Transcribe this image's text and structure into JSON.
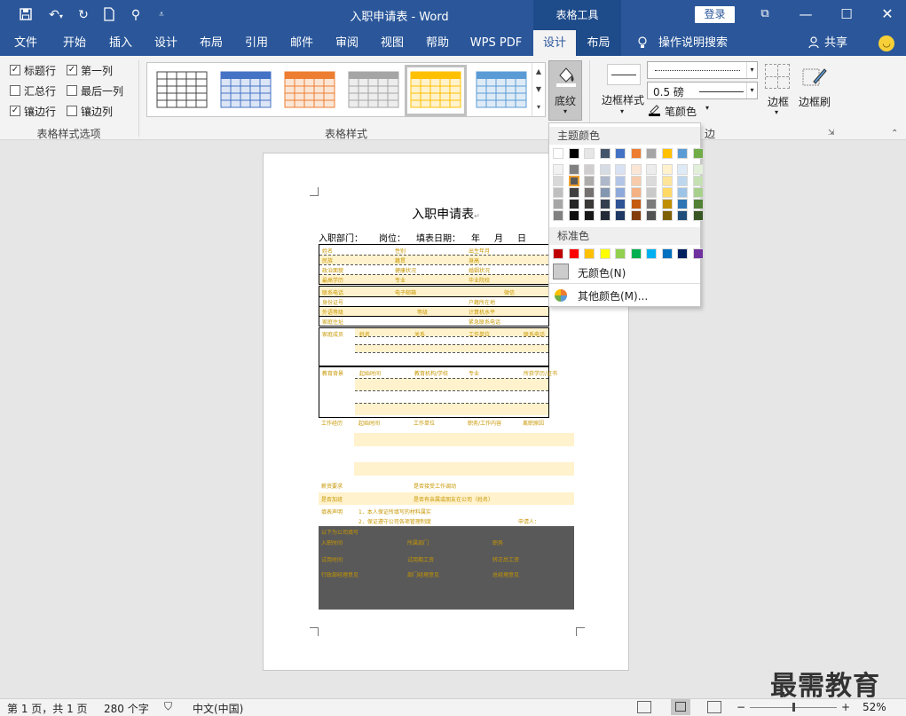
{
  "window": {
    "title": "入职申请表 - Word",
    "context_tab_title": "表格工具",
    "login": "登录"
  },
  "tabs": [
    "文件",
    "开始",
    "插入",
    "设计",
    "布局",
    "引用",
    "邮件",
    "审阅",
    "视图",
    "帮助",
    "WPS PDF",
    "设计",
    "布局"
  ],
  "tell_me": "操作说明搜索",
  "share": "共享",
  "options": {
    "items": [
      {
        "label": "标题行",
        "checked": true
      },
      {
        "label": "第一列",
        "checked": true
      },
      {
        "label": "汇总行",
        "checked": false
      },
      {
        "label": "最后一列",
        "checked": false
      },
      {
        "label": "镶边行",
        "checked": true
      },
      {
        "label": "镶边列",
        "checked": false
      }
    ],
    "group_label": "表格样式选项"
  },
  "styles": {
    "group_label": "表格样式"
  },
  "shading": {
    "label": "底纹"
  },
  "border": {
    "styles_label": "边框样式",
    "width": "0.5 磅",
    "pen_color": "笔颜色",
    "borders": "边框",
    "painter": "边框刷",
    "group_label": "边框"
  },
  "dropdown": {
    "theme_label": "主题颜色",
    "standard_label": "标准色",
    "no_color": "无颜色(N)",
    "more_colors": "其他颜色(M)...",
    "theme_top": [
      "#ffffff",
      "#000000",
      "#e7e6e6",
      "#44546a",
      "#4472c4",
      "#ed7d31",
      "#a5a5a5",
      "#ffc000",
      "#5b9bd5",
      "#70ad47"
    ],
    "theme_shades": [
      [
        "#f2f2f2",
        "#d9d9d9",
        "#bfbfbf",
        "#a6a6a6",
        "#808080"
      ],
      [
        "#808080",
        "#595959",
        "#404040",
        "#262626",
        "#0d0d0d"
      ],
      [
        "#d0cece",
        "#afabab",
        "#767171",
        "#3b3838",
        "#181717"
      ],
      [
        "#d6dce4",
        "#adb9ca",
        "#8497b0",
        "#333f4f",
        "#222a35"
      ],
      [
        "#d9e2f3",
        "#b4c6e7",
        "#8eaadb",
        "#2f5496",
        "#1f3864"
      ],
      [
        "#fbe5d5",
        "#f7cbac",
        "#f4b183",
        "#c55a11",
        "#833c0b"
      ],
      [
        "#ededed",
        "#dbdbdb",
        "#c9c9c9",
        "#7b7b7b",
        "#525252"
      ],
      [
        "#fff2cc",
        "#fee599",
        "#ffd965",
        "#bf8f00",
        "#7f6000"
      ],
      [
        "#deebf6",
        "#bdd7ee",
        "#9dc3e6",
        "#2e75b5",
        "#1e4e79"
      ],
      [
        "#e2efd9",
        "#c5e0b3",
        "#a8d08d",
        "#538135",
        "#375623"
      ]
    ],
    "standard": [
      "#c00000",
      "#ff0000",
      "#ffc000",
      "#ffff00",
      "#92d050",
      "#00b050",
      "#00b0f0",
      "#0070c0",
      "#002060",
      "#7030a0"
    ]
  },
  "document": {
    "title": "入职申请表",
    "header": [
      "入职部门：",
      "岗位：",
      "填表日期：",
      "年",
      "月",
      "日"
    ],
    "rows1": [
      [
        "姓名",
        "性别",
        "出生年月"
      ],
      [
        "民族",
        "籍贯",
        "身高"
      ],
      [
        "政治面貌",
        "健康状况",
        "婚姻状况"
      ],
      [
        "最高学历",
        "专业",
        "毕业院校"
      ]
    ],
    "rows2": [
      [
        "联系电话",
        "电子邮箱",
        "微信"
      ],
      [
        "身份证号",
        "户籍所在地"
      ],
      [
        "外语等级",
        "等级",
        "计算机水平"
      ],
      [
        "家庭住址",
        "紧急联系电话"
      ]
    ],
    "family": [
      "家庭成员",
      "姓名",
      "关系",
      "工作单位",
      "联系电话"
    ],
    "edu": [
      "教育背景",
      "起始时间",
      "教育机构/学校",
      "专业",
      "所获学历/证书"
    ],
    "work": [
      "工作经历",
      "起始时间",
      "工作单位",
      "职务/工作内容",
      "离职原因"
    ],
    "salary": [
      "薪资要求",
      "是否接受工作调动"
    ],
    "relatives": [
      "是否加班",
      "是否有亲属或朋友在公司（姓名）"
    ],
    "statement": [
      "填表声明",
      "1．本人保证所填写的材料属实",
      "2．保证遵守公司各项管理制度",
      "申请人："
    ],
    "office": [
      "以下为公司填写",
      "入职时间",
      "所属部门",
      "职务",
      "试用时间",
      "试用期工资",
      "转正后工资",
      "行政部经理意见",
      "部门经理意见",
      "总经理意见"
    ]
  },
  "status": {
    "page": "第 1 页，共 1 页",
    "words": "280 个字",
    "lang": "中文(中国)",
    "zoom": "52%"
  },
  "watermark": "最需教育"
}
